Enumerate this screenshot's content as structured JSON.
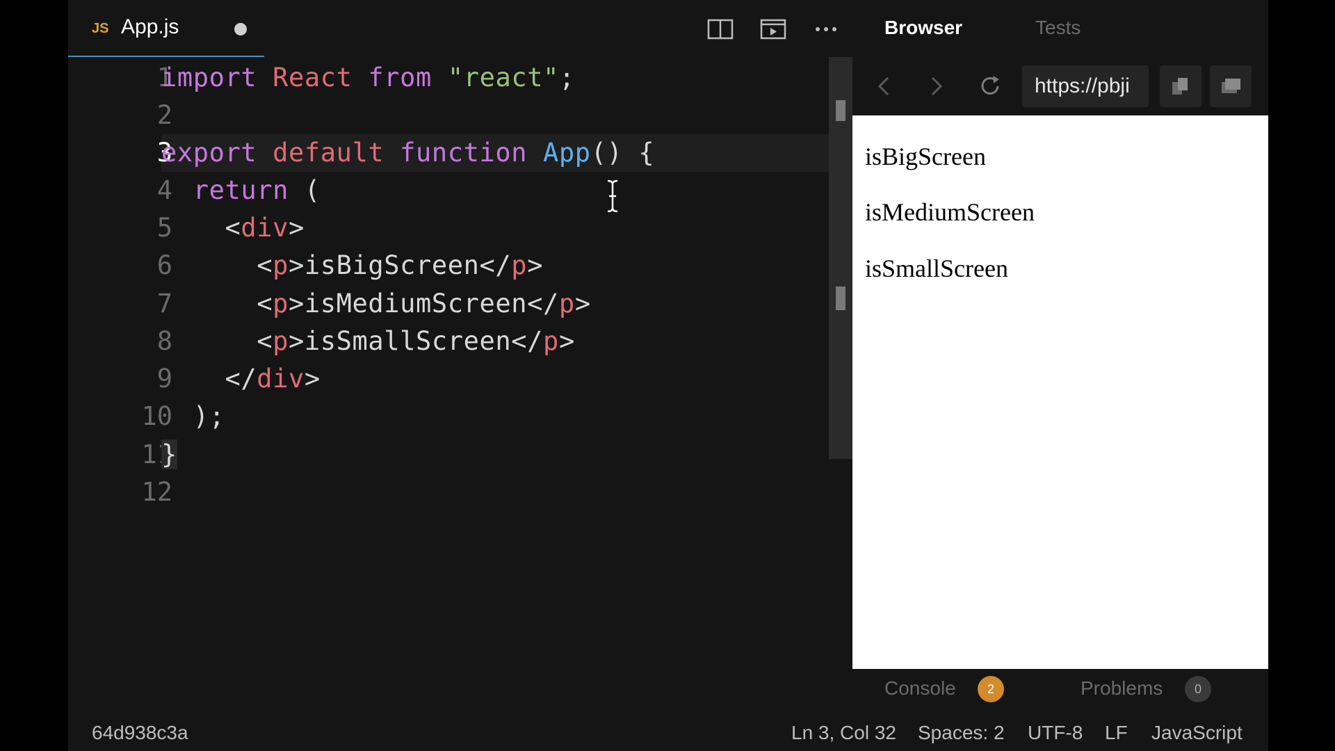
{
  "editor": {
    "tab": {
      "badge": "JS",
      "filename": "App.js"
    },
    "toolbar": {
      "split_icon": "split-editor-icon",
      "preview_icon": "open-preview-icon",
      "more_icon": "more-actions-icon"
    },
    "line_numbers": [
      "1",
      "2",
      "3",
      "4",
      "5",
      "6",
      "7",
      "8",
      "9",
      "10",
      "11",
      "12"
    ],
    "active_line": 3,
    "code": {
      "l1": {
        "kw1": "import",
        "id": " React ",
        "kw2": "from",
        "sp": " ",
        "str": "\"react\"",
        "end": ";"
      },
      "l3": {
        "kw1": "export",
        "kw2": " default",
        "kw3": " function",
        "fn": " App",
        "rest": "() {"
      },
      "l4": {
        "kw": "  return",
        "rest": " ("
      },
      "l5": {
        "open": "    <",
        "tag": "div",
        "close": ">"
      },
      "l6": {
        "open": "      <",
        "tag": "p",
        "mid": ">isBigScreen</",
        "tag2": "p",
        "close": ">"
      },
      "l7": {
        "open": "      <",
        "tag": "p",
        "mid": ">isMediumScreen</",
        "tag2": "p",
        "close": ">"
      },
      "l8": {
        "open": "      <",
        "tag": "p",
        "mid": ">isSmallScreen</",
        "tag2": "p",
        "close": ">"
      },
      "l9": {
        "open": "    </",
        "tag": "div",
        "close": ">"
      },
      "l10": {
        "text": "  );"
      },
      "l11": {
        "text": "}"
      }
    }
  },
  "browser_panel": {
    "tabs": {
      "browser": "Browser",
      "tests": "Tests"
    },
    "url": "https://pbji",
    "preview": {
      "lines": [
        "isBigScreen",
        "isMediumScreen",
        "isSmallScreen"
      ]
    },
    "console": {
      "label": "Console",
      "count": "2"
    },
    "problems": {
      "label": "Problems",
      "count": "0"
    }
  },
  "status_bar": {
    "commit": "64d938c3a",
    "position": "Ln 3, Col 32",
    "spaces": "Spaces: 2",
    "encoding": "UTF-8",
    "eol": "LF",
    "language": "JavaScript"
  },
  "colors": {
    "keyword": "#c678dd",
    "identifier": "#e06c75",
    "string": "#98c379",
    "function": "#61afef",
    "warning_badge": "#d28a2b"
  }
}
